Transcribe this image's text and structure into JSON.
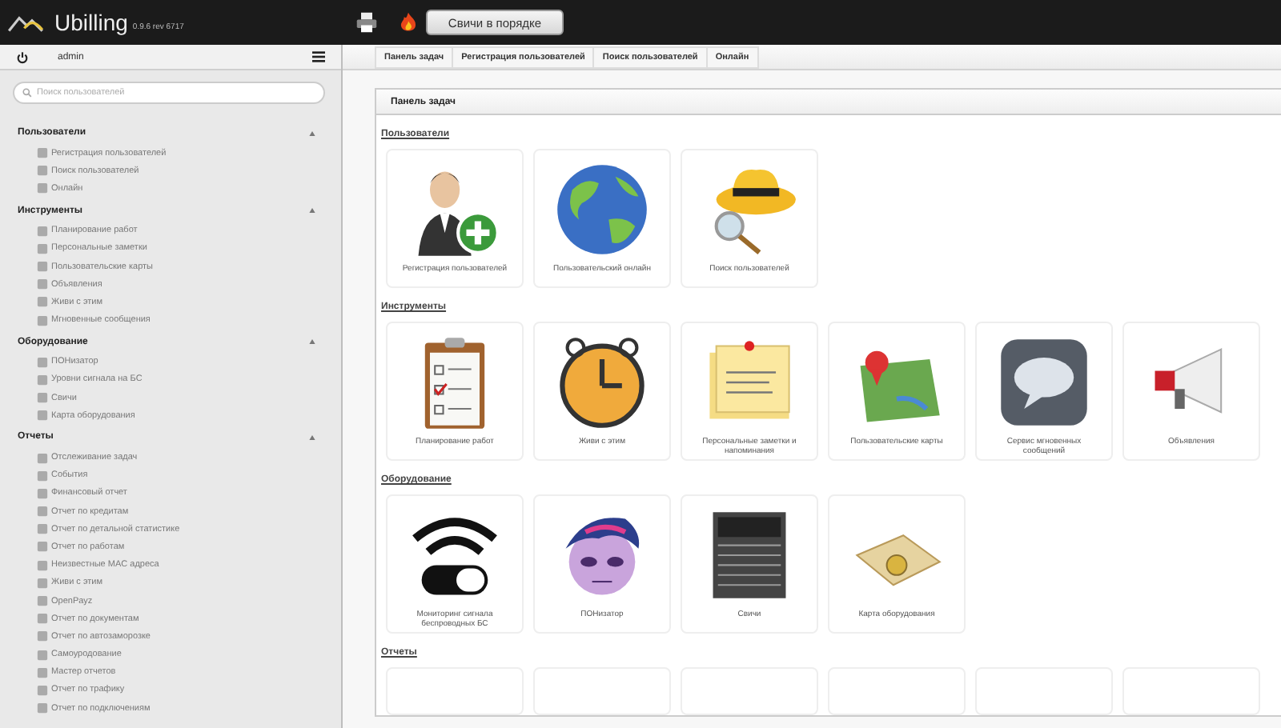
{
  "topbar": {
    "brand": "Ubilling",
    "version": "0.9.6 rev 6717",
    "status_button": "Свичи в порядке"
  },
  "sidebar": {
    "user": "admin",
    "search": {
      "placeholder": "Поиск пользователей"
    },
    "sections": [
      {
        "title": "Пользователи",
        "expanded": true,
        "items": [
          "Регистрация пользователей",
          "Поиск пользователей",
          "Онлайн"
        ]
      },
      {
        "title": "Инструменты",
        "expanded": true,
        "items": [
          "Планирование работ",
          "Персональные заметки",
          "Пользовательские карты",
          "Объявления",
          "Живи с этим",
          "Мгновенные сообщения"
        ]
      },
      {
        "title": "Оборудование",
        "expanded": true,
        "items": [
          "ПОНизатор",
          "Уровни сигнала на БС",
          "Свичи",
          "Карта оборудования"
        ]
      },
      {
        "title": "Отчеты",
        "expanded": true,
        "items": [
          "Отслеживание задач",
          "События",
          "Финансовый отчет",
          "Отчет по кредитам",
          "Отчет по детальной статистике",
          "Отчет по работам",
          "Неизвестные MAC адреса",
          "Живи с этим",
          "OpenPayz",
          "Отчет по документам",
          "Отчет по автозаморозке",
          "Самоуродование",
          "Мастер отчетов",
          "Отчет по трафику",
          "Отчет по подключениям"
        ]
      }
    ]
  },
  "breadcrumbs": [
    "Панель задач",
    "Регистрация пользователей",
    "Поиск пользователей",
    "Онлайн"
  ],
  "panel": {
    "title": "Панель задач",
    "sections": [
      {
        "title": "Пользователи",
        "tiles": [
          {
            "kind": "tile",
            "label": "Регистрация пользователей"
          },
          {
            "kind": "tile",
            "label": "Пользовательский онлайн"
          },
          {
            "kind": "tile",
            "label": "Поиск пользователей"
          }
        ]
      },
      {
        "title": "Инструменты",
        "tiles": [
          {
            "kind": "tile",
            "label": "Планирование работ"
          },
          {
            "kind": "tile",
            "label": "Живи с этим"
          },
          {
            "kind": "tile",
            "label": "Персональные заметки и напоминания"
          },
          {
            "kind": "tile",
            "label": "Пользовательские карты"
          },
          {
            "kind": "tile",
            "label": "Сервис мгновенных сообщений"
          },
          {
            "kind": "tile",
            "label": "Объявления"
          }
        ]
      },
      {
        "title": "Оборудование",
        "tiles": [
          {
            "kind": "tile",
            "label": "Мониторинг сигнала беспроводных БС"
          },
          {
            "kind": "tile",
            "label": "ПОНизатор"
          },
          {
            "kind": "tile",
            "label": "Свичи"
          },
          {
            "kind": "tile",
            "label": "Карта оборудования"
          }
        ]
      },
      {
        "title": "Отчеты",
        "tiles": [
          {
            "kind": "cut"
          },
          {
            "kind": "cut"
          },
          {
            "kind": "cut"
          },
          {
            "kind": "cut"
          },
          {
            "kind": "cut"
          },
          {
            "kind": "cut"
          }
        ]
      }
    ]
  }
}
